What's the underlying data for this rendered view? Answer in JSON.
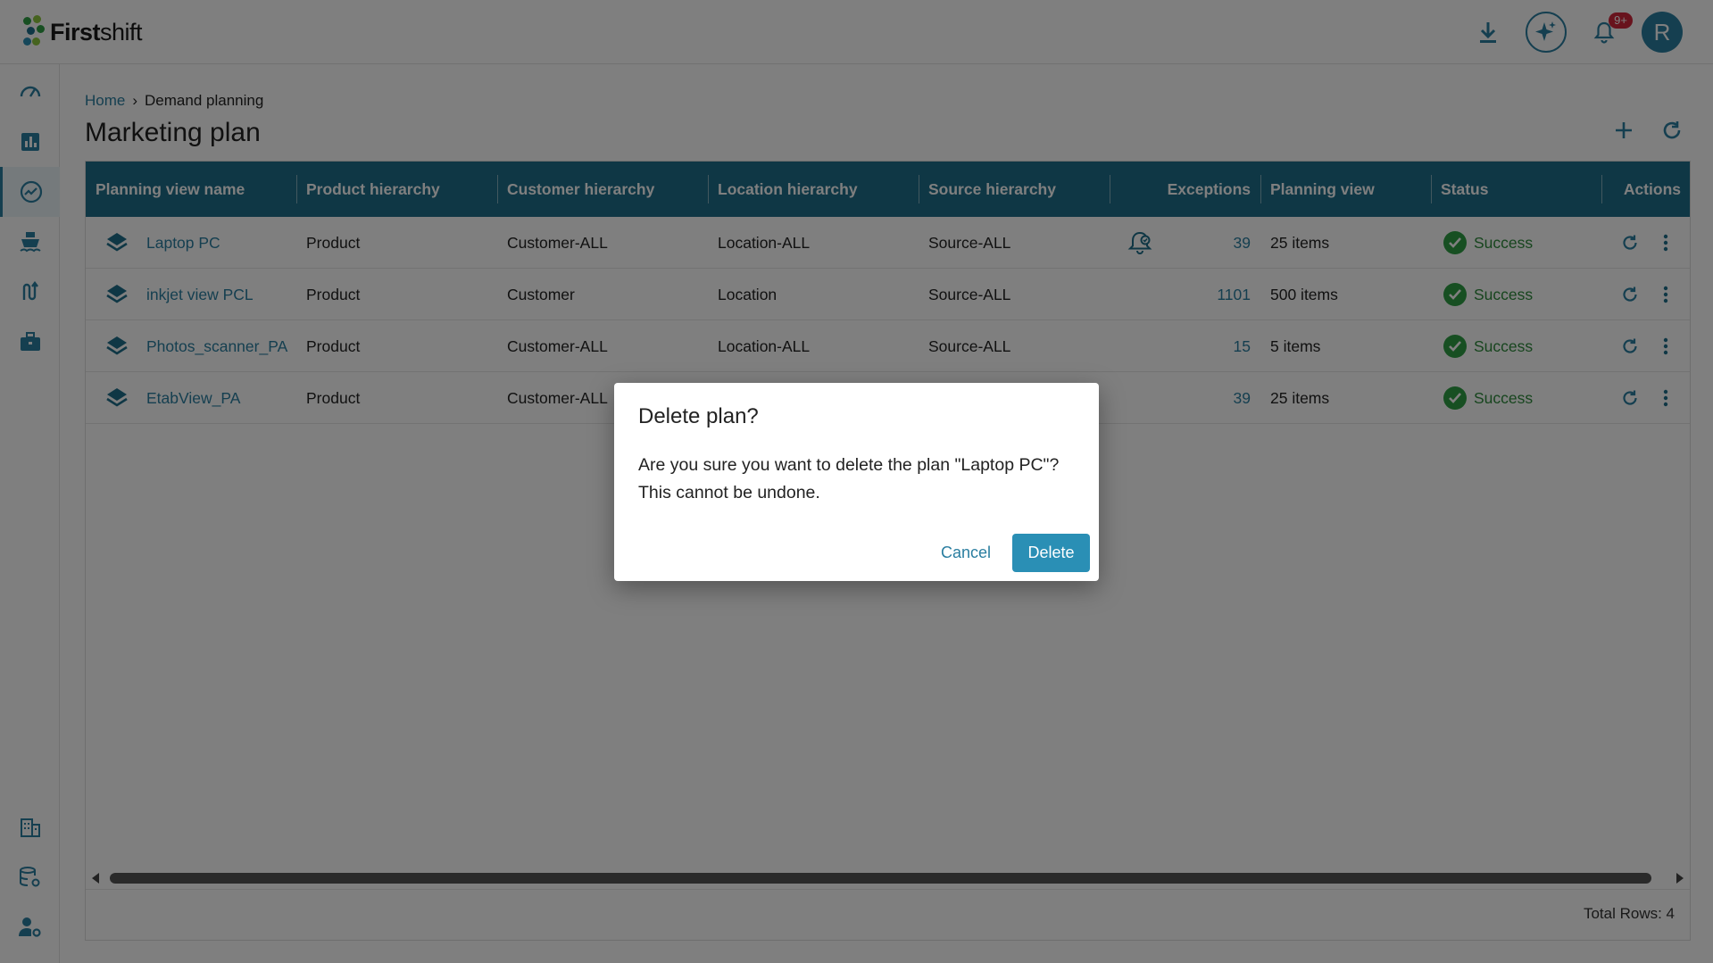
{
  "app": {
    "name_bold": "First",
    "name_light": "shift"
  },
  "header": {
    "notification_badge": "9+",
    "avatar_initial": "R"
  },
  "breadcrumb": {
    "home": "Home",
    "separator": "›",
    "current": "Demand planning"
  },
  "page": {
    "title": "Marketing plan"
  },
  "table": {
    "columns": [
      "Planning view name",
      "Product hierarchy",
      "Customer hierarchy",
      "Location hierarchy",
      "Source hierarchy",
      "Exceptions",
      "Planning view",
      "Status",
      "Actions"
    ],
    "rows": [
      {
        "name": "Laptop PC",
        "product": "Product",
        "customer": "Customer-ALL",
        "location": "Location-ALL",
        "source": "Source-ALL",
        "exceptions": "39",
        "planning_view": "25 items",
        "status": "Success"
      },
      {
        "name": "inkjet view PCL",
        "product": "Product",
        "customer": "Customer",
        "location": "Location",
        "source": "Source-ALL",
        "exceptions": "1101",
        "planning_view": "500 items",
        "status": "Success"
      },
      {
        "name": "Photos_scanner_PA",
        "product": "Product",
        "customer": "Customer-ALL",
        "location": "Location-ALL",
        "source": "Source-ALL",
        "exceptions": "15",
        "planning_view": "5 items",
        "status": "Success"
      },
      {
        "name": "EtabView_PA",
        "product": "Product",
        "customer": "Customer-ALL",
        "location": "",
        "source": "",
        "exceptions": "39",
        "planning_view": "25 items",
        "status": "Success"
      }
    ],
    "total_rows": "Total Rows: 4"
  },
  "dialog": {
    "title": "Delete plan?",
    "message_line1": "Are you sure you want to delete the plan \"Laptop PC\"?",
    "message_line2": "This cannot be undone.",
    "cancel_label": "Cancel",
    "delete_label": "Delete"
  },
  "colors": {
    "brand": "#1f6f8b",
    "accent": "#2a7ea0",
    "success": "#2e9e44",
    "danger": "#d0263a"
  }
}
